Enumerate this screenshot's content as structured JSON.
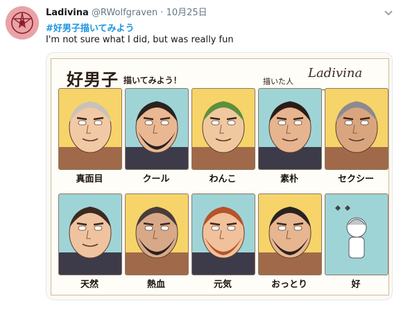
{
  "tweet": {
    "display_name": "Ladivina",
    "handle": "@RWolfgraven",
    "separator": "·",
    "date": "10月25日",
    "hashtag": "#好男子描いてみよう",
    "text": "I'm not sure what I did, but was really fun"
  },
  "image": {
    "title": "好男子",
    "subtitle": "描いてみよう！",
    "drawn_by": "描いた人",
    "signature": "Ladivina",
    "panels": [
      {
        "label": "真面目",
        "bg": "#f6d46a"
      },
      {
        "label": "クール",
        "bg": "#9fd4d7"
      },
      {
        "label": "わんこ",
        "bg": "#f6d46a"
      },
      {
        "label": "素朴",
        "bg": "#9fd4d7"
      },
      {
        "label": "セクシー",
        "bg": "#f6d46a"
      },
      {
        "label": "天然",
        "bg": "#9fd4d7"
      },
      {
        "label": "熱血",
        "bg": "#f6d46a"
      },
      {
        "label": "元気",
        "bg": "#9fd4d7"
      },
      {
        "label": "おっとり",
        "bg": "#f6d46a"
      },
      {
        "label": "好",
        "bg": "#9fd4d7"
      }
    ]
  },
  "colors": {
    "hashtag": "#1b95e0",
    "handle": "#657786",
    "avatar_bg": "#e9a3a6"
  },
  "icons": {
    "avatar": "pentagram-avatar",
    "menu": "chevron-down-icon"
  }
}
